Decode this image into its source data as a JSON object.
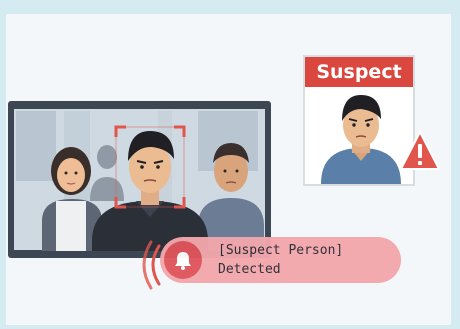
{
  "suspect_card": {
    "title": "Suspect"
  },
  "alert": {
    "line1": "[Suspect Person]",
    "line2": "Detected",
    "icon": "bell-icon"
  },
  "colors": {
    "alert_red": "#d9473f",
    "alert_pill": "#f2a7ac",
    "face_box": "#e0554c",
    "background": "#d4ecf1"
  }
}
